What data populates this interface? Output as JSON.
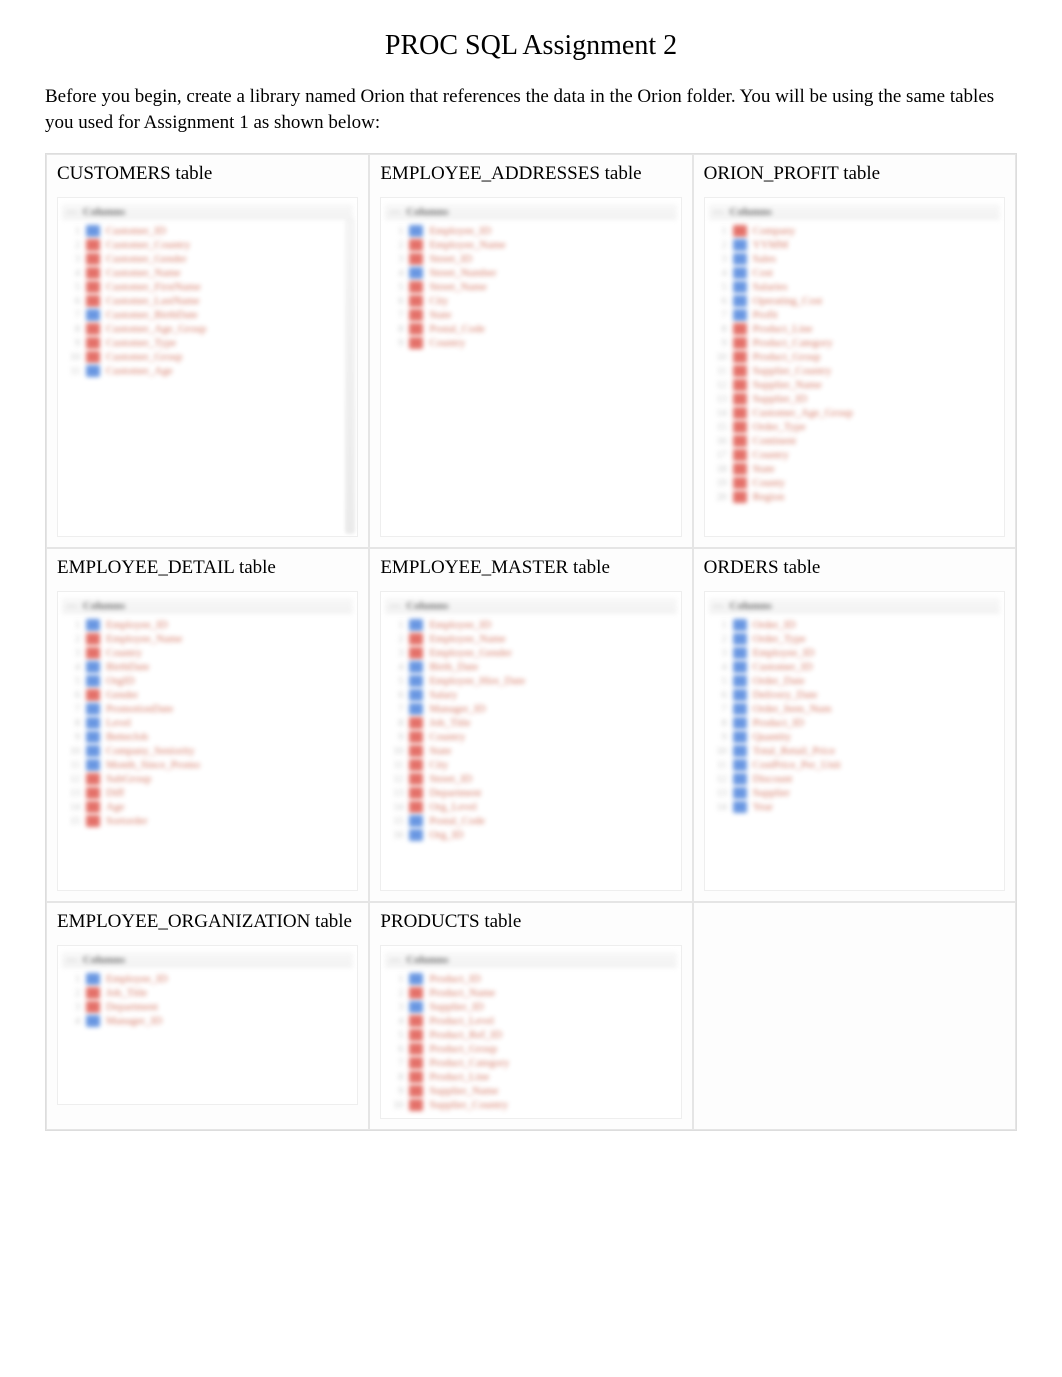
{
  "title": "PROC SQL Assignment 2",
  "intro": "Before you begin, create a library named Orion that references the data in the Orion folder.     You will be using the same tables you used for Assignment 1 as shown below:",
  "panel_caption": "Columns",
  "tables": {
    "customers": {
      "label": "CUSTOMERS table",
      "columns": [
        {
          "n": 1,
          "type": "num",
          "name": "Customer_ID"
        },
        {
          "n": 2,
          "type": "char",
          "name": "Customer_Country"
        },
        {
          "n": 3,
          "type": "char",
          "name": "Customer_Gender"
        },
        {
          "n": 4,
          "type": "char",
          "name": "Customer_Name"
        },
        {
          "n": 5,
          "type": "char",
          "name": "Customer_FirstName"
        },
        {
          "n": 6,
          "type": "char",
          "name": "Customer_LastName"
        },
        {
          "n": 7,
          "type": "num",
          "name": "Customer_BirthDate"
        },
        {
          "n": 8,
          "type": "char",
          "name": "Customer_Age_Group"
        },
        {
          "n": 9,
          "type": "char",
          "name": "Customer_Type"
        },
        {
          "n": 10,
          "type": "char",
          "name": "Customer_Group"
        },
        {
          "n": 11,
          "type": "num",
          "name": "Customer_Age"
        }
      ]
    },
    "employee_addresses": {
      "label": "EMPLOYEE_ADDRESSES table",
      "columns": [
        {
          "n": 1,
          "type": "num",
          "name": "Employee_ID"
        },
        {
          "n": 2,
          "type": "char",
          "name": "Employee_Name"
        },
        {
          "n": 3,
          "type": "char",
          "name": "Street_ID"
        },
        {
          "n": 4,
          "type": "num",
          "name": "Street_Number"
        },
        {
          "n": 5,
          "type": "char",
          "name": "Street_Name"
        },
        {
          "n": 6,
          "type": "char",
          "name": "City"
        },
        {
          "n": 7,
          "type": "char",
          "name": "State"
        },
        {
          "n": 8,
          "type": "char",
          "name": "Postal_Code"
        },
        {
          "n": 9,
          "type": "char",
          "name": "Country"
        }
      ]
    },
    "orion_profit": {
      "label": "ORION_PROFIT table",
      "columns": [
        {
          "n": 1,
          "type": "char",
          "name": "Company"
        },
        {
          "n": 2,
          "type": "num",
          "name": "YYMM"
        },
        {
          "n": 3,
          "type": "num",
          "name": "Sales"
        },
        {
          "n": 4,
          "type": "num",
          "name": "Cost"
        },
        {
          "n": 5,
          "type": "num",
          "name": "Salaries"
        },
        {
          "n": 6,
          "type": "num",
          "name": "Operating_Cost"
        },
        {
          "n": 7,
          "type": "num",
          "name": "Profit"
        },
        {
          "n": 8,
          "type": "char",
          "name": "Product_Line"
        },
        {
          "n": 9,
          "type": "char",
          "name": "Product_Category"
        },
        {
          "n": 10,
          "type": "char",
          "name": "Product_Group"
        },
        {
          "n": 11,
          "type": "char",
          "name": "Supplier_Country"
        },
        {
          "n": 12,
          "type": "char",
          "name": "Supplier_Name"
        },
        {
          "n": 13,
          "type": "char",
          "name": "Supplier_ID"
        },
        {
          "n": 14,
          "type": "char",
          "name": "Customer_Age_Group"
        },
        {
          "n": 15,
          "type": "char",
          "name": "Order_Type"
        },
        {
          "n": 16,
          "type": "char",
          "name": "Continent"
        },
        {
          "n": 17,
          "type": "char",
          "name": "Country"
        },
        {
          "n": 18,
          "type": "char",
          "name": "State"
        },
        {
          "n": 19,
          "type": "char",
          "name": "County"
        },
        {
          "n": 20,
          "type": "char",
          "name": "Region"
        }
      ]
    },
    "employee_detail": {
      "label": "EMPLOYEE_DETAIL table",
      "columns": [
        {
          "n": 1,
          "type": "num",
          "name": "Employee_ID"
        },
        {
          "n": 2,
          "type": "char",
          "name": "Employee_Name"
        },
        {
          "n": 3,
          "type": "char",
          "name": "Country"
        },
        {
          "n": 4,
          "type": "num",
          "name": "BirthDate"
        },
        {
          "n": 5,
          "type": "num",
          "name": "OrgID"
        },
        {
          "n": 6,
          "type": "char",
          "name": "Gender"
        },
        {
          "n": 7,
          "type": "num",
          "name": "PromotionDate"
        },
        {
          "n": 8,
          "type": "num",
          "name": "Level"
        },
        {
          "n": 9,
          "type": "num",
          "name": "BetterJob"
        },
        {
          "n": 10,
          "type": "num",
          "name": "Company_Seniority"
        },
        {
          "n": 11,
          "type": "num",
          "name": "Month_Since_Promo"
        },
        {
          "n": 12,
          "type": "char",
          "name": "SubGroup"
        },
        {
          "n": 13,
          "type": "char",
          "name": "Diff"
        },
        {
          "n": 14,
          "type": "char",
          "name": "Age"
        },
        {
          "n": 15,
          "type": "char",
          "name": "Sortorder"
        }
      ]
    },
    "employee_master": {
      "label": "EMPLOYEE_MASTER table",
      "columns": [
        {
          "n": 1,
          "type": "num",
          "name": "Employee_ID"
        },
        {
          "n": 2,
          "type": "char",
          "name": "Employee_Name"
        },
        {
          "n": 3,
          "type": "char",
          "name": "Employee_Gender"
        },
        {
          "n": 4,
          "type": "num",
          "name": "Birth_Date"
        },
        {
          "n": 5,
          "type": "num",
          "name": "Employee_Hire_Date"
        },
        {
          "n": 6,
          "type": "num",
          "name": "Salary"
        },
        {
          "n": 7,
          "type": "num",
          "name": "Manager_ID"
        },
        {
          "n": 8,
          "type": "char",
          "name": "Job_Title"
        },
        {
          "n": 9,
          "type": "char",
          "name": "Country"
        },
        {
          "n": 10,
          "type": "char",
          "name": "State"
        },
        {
          "n": 11,
          "type": "char",
          "name": "City"
        },
        {
          "n": 12,
          "type": "char",
          "name": "Street_ID"
        },
        {
          "n": 13,
          "type": "char",
          "name": "Department"
        },
        {
          "n": 14,
          "type": "char",
          "name": "Org_Level"
        },
        {
          "n": 15,
          "type": "num",
          "name": "Postal_Code"
        },
        {
          "n": 16,
          "type": "num",
          "name": "Org_ID"
        }
      ]
    },
    "orders": {
      "label": "ORDERS table",
      "columns": [
        {
          "n": 1,
          "type": "num",
          "name": "Order_ID"
        },
        {
          "n": 2,
          "type": "num",
          "name": "Order_Type"
        },
        {
          "n": 3,
          "type": "num",
          "name": "Employee_ID"
        },
        {
          "n": 4,
          "type": "num",
          "name": "Customer_ID"
        },
        {
          "n": 5,
          "type": "num",
          "name": "Order_Date"
        },
        {
          "n": 6,
          "type": "num",
          "name": "Delivery_Date"
        },
        {
          "n": 7,
          "type": "num",
          "name": "Order_Item_Num"
        },
        {
          "n": 8,
          "type": "num",
          "name": "Product_ID"
        },
        {
          "n": 9,
          "type": "num",
          "name": "Quantity"
        },
        {
          "n": 10,
          "type": "num",
          "name": "Total_Retail_Price"
        },
        {
          "n": 11,
          "type": "num",
          "name": "CostPrice_Per_Unit"
        },
        {
          "n": 12,
          "type": "num",
          "name": "Discount"
        },
        {
          "n": 13,
          "type": "num",
          "name": "Supplier"
        },
        {
          "n": 14,
          "type": "num",
          "name": "Year"
        }
      ]
    },
    "employee_organization": {
      "label": "EMPLOYEE_ORGANIZATION table",
      "columns": [
        {
          "n": 1,
          "type": "num",
          "name": "Employee_ID"
        },
        {
          "n": 2,
          "type": "char",
          "name": "Job_Title"
        },
        {
          "n": 3,
          "type": "char",
          "name": "Department"
        },
        {
          "n": 4,
          "type": "num",
          "name": "Manager_ID"
        }
      ]
    },
    "products": {
      "label": "PRODUCTS table",
      "columns": [
        {
          "n": 1,
          "type": "num",
          "name": "Product_ID"
        },
        {
          "n": 2,
          "type": "char",
          "name": "Product_Name"
        },
        {
          "n": 3,
          "type": "num",
          "name": "Supplier_ID"
        },
        {
          "n": 4,
          "type": "char",
          "name": "Product_Level"
        },
        {
          "n": 5,
          "type": "char",
          "name": "Product_Ref_ID"
        },
        {
          "n": 6,
          "type": "char",
          "name": "Product_Group"
        },
        {
          "n": 7,
          "type": "char",
          "name": "Product_Category"
        },
        {
          "n": 8,
          "type": "char",
          "name": "Product_Line"
        },
        {
          "n": 9,
          "type": "char",
          "name": "Supplier_Name"
        },
        {
          "n": 10,
          "type": "char",
          "name": "Supplier_Country"
        }
      ]
    }
  }
}
